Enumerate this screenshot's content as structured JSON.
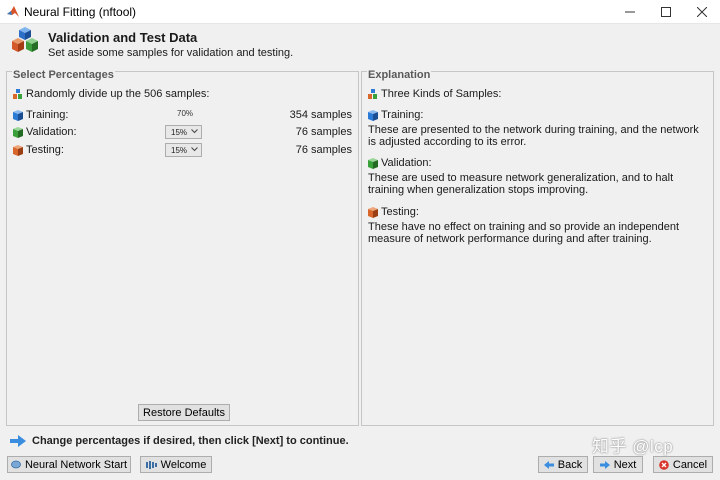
{
  "window": {
    "title": "Neural Fitting (nftool)"
  },
  "header": {
    "title": "Validation and Test Data",
    "subtitle": "Set aside some samples for validation and testing."
  },
  "select_panel": {
    "legend": "Select Percentages",
    "intro": "Randomly divide up the 506 samples:",
    "rows": [
      {
        "label": "Training:",
        "percent": "70%",
        "samples": "354 samples",
        "icon": "blue-cube-icon",
        "color": "#2b7bd6"
      },
      {
        "label": "Validation:",
        "percent": "15%",
        "samples": "76 samples",
        "icon": "green-cube-icon",
        "color": "#3aa13a"
      },
      {
        "label": "Testing:",
        "percent": "15%",
        "samples": "76 samples",
        "icon": "orange-cube-icon",
        "color": "#d9662b"
      }
    ],
    "restore_label": "Restore Defaults"
  },
  "explanation_panel": {
    "legend": "Explanation",
    "intro": "Three Kinds of Samples:",
    "items": [
      {
        "title": "Training:",
        "text": "These are presented to the network during training, and the network is adjusted according to its error."
      },
      {
        "title": "Validation:",
        "text": "These are used to measure network generalization, and to halt training when generalization stops improving."
      },
      {
        "title": "Testing:",
        "text": "These have no effect on training and so provide an independent measure of network performance during and after training."
      }
    ]
  },
  "footer": {
    "message": "Change percentages if desired, then click [Next] to continue.",
    "buttons": {
      "nn_start": "Neural Network Start",
      "welcome": "Welcome",
      "back": "Back",
      "next": "Next",
      "cancel": "Cancel"
    }
  },
  "watermark": "知乎 @lcp"
}
